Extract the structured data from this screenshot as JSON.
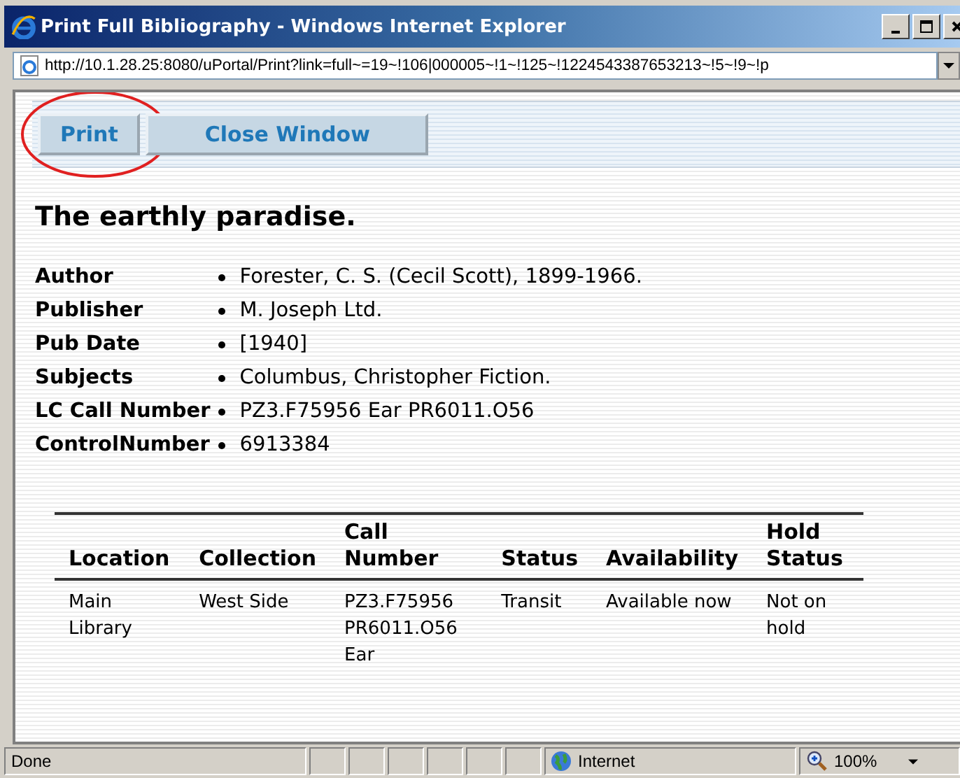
{
  "window": {
    "title": "Print Full Bibliography - Windows Internet Explorer"
  },
  "address_bar": {
    "url": "http://10.1.28.25:8080/uPortal/Print?link=full~=19~!106|000005~!1~!125~!1224543387653213~!5~!9~!p"
  },
  "toolbar": {
    "buttons": [
      {
        "label": "Print",
        "highlighted": true
      },
      {
        "label": "Close Window",
        "highlighted": false
      }
    ]
  },
  "record": {
    "title": "The earthly paradise.",
    "fields": [
      {
        "label": "Author",
        "value": "Forester, C. S. (Cecil Scott), 1899-1966."
      },
      {
        "label": "Publisher",
        "value": "M. Joseph Ltd."
      },
      {
        "label": "Pub Date",
        "value": "[1940]"
      },
      {
        "label": "Subjects",
        "value": "Columbus, Christopher Fiction."
      },
      {
        "label": "LC Call Number",
        "value": "PZ3.F75956 Ear PR6011.O56"
      },
      {
        "label": "ControlNumber",
        "value": "6913384"
      }
    ]
  },
  "holdings": {
    "columns": [
      "Location",
      "Collection",
      "Call Number",
      "Status",
      "Availability",
      "Hold Status"
    ],
    "rows": [
      [
        "Main Library",
        "West Side",
        "PZ3.F75956 PR6011.O56 Ear",
        "Transit",
        "Available now",
        "Not on hold"
      ]
    ]
  },
  "status_bar": {
    "text": "Done",
    "zone": "Internet",
    "zoom": "100%"
  }
}
